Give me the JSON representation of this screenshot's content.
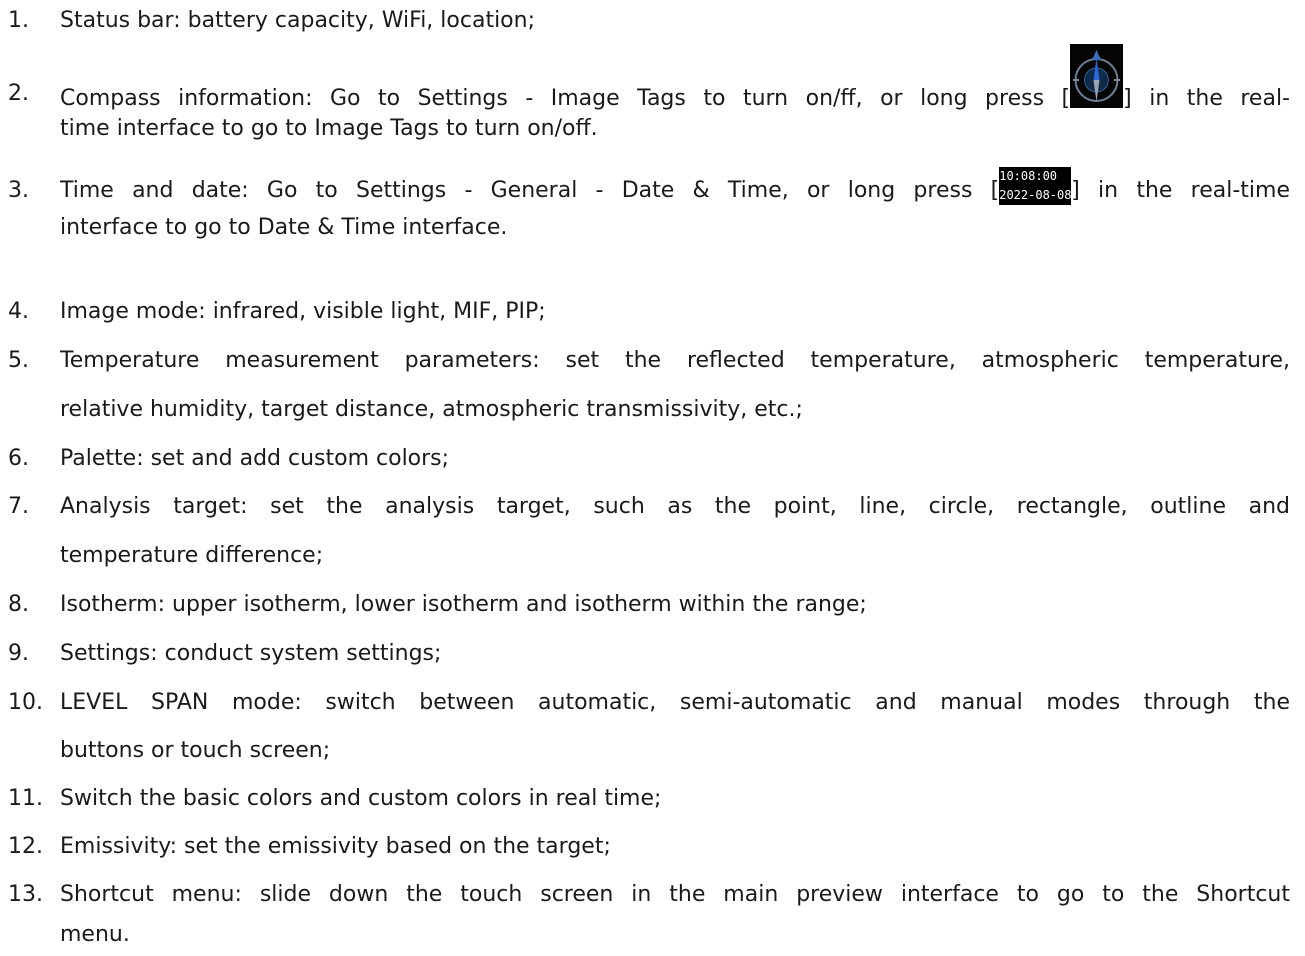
{
  "items": [
    {
      "number": "1.",
      "lines": [
        "Status bar: battery capacity, WiFi, location;"
      ]
    },
    {
      "number": "2.",
      "line1_before_icon": "Compass information: Go to Settings - Image Tags to turn on/ff, or long press [",
      "line1_after_icon": "] in the real-",
      "line2": "time interface to go to Image Tags to turn on/off.",
      "icon": "compass-icon"
    },
    {
      "number": "3.",
      "line1_before_icon": "Time and date: Go to Settings - General - Date & Time, or long press [",
      "line1_after_icon": "] in the real-time",
      "line2": "interface to go to Date & Time interface.",
      "icon_time": "10:08:00",
      "icon_date": "2022-08-08"
    },
    {
      "number": "4.",
      "lines": [
        "Image mode: infrared, visible light, MIF, PIP;"
      ]
    },
    {
      "number": "5.",
      "lines": [
        "Temperature measurement parameters: set the reflected temperature, atmospheric temperature,",
        "relative humidity, target distance, atmospheric transmissivity, etc.;"
      ]
    },
    {
      "number": "6.",
      "lines": [
        "Palette: set and add custom colors;"
      ]
    },
    {
      "number": "7.",
      "lines": [
        "Analysis target: set the analysis target, such as the point, line, circle, rectangle, outline and",
        "temperature difference;"
      ]
    },
    {
      "number": "8.",
      "lines": [
        "Isotherm: upper isotherm, lower isotherm and isotherm within the range;"
      ]
    },
    {
      "number": "9.",
      "lines": [
        "Settings: conduct system settings;"
      ]
    },
    {
      "number": "10.",
      "lines": [
        "LEVEL SPAN mode: switch between automatic, semi-automatic and manual modes through the",
        "buttons or touch screen;"
      ]
    },
    {
      "number": "11.",
      "lines": [
        "Switch the basic colors and custom colors in real time;"
      ]
    },
    {
      "number": "12.",
      "lines": [
        "Emissivity: set the emissivity based on the target;"
      ]
    },
    {
      "number": "13.",
      "lines": [
        "Shortcut menu: slide down the touch screen in the main preview interface to go to the Shortcut",
        "menu."
      ]
    }
  ]
}
